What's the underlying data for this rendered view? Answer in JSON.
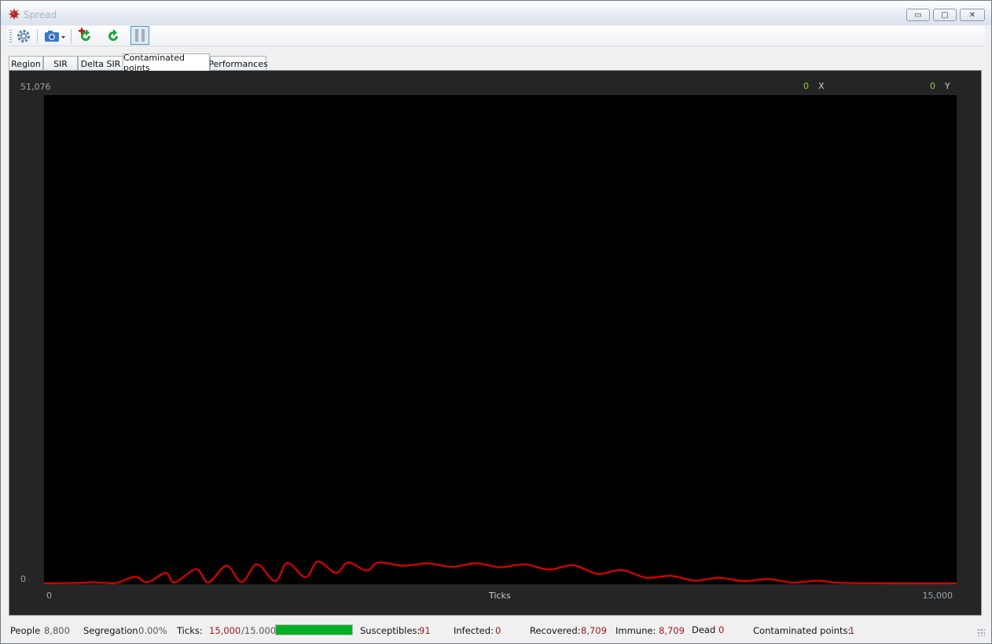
{
  "window": {
    "title": "Spread",
    "minimize_glyph": "▭",
    "maximize_glyph": "▢",
    "close_glyph": "✕"
  },
  "toolbar": {
    "icons": [
      "gear-icon",
      "camera-dropdown-icon",
      "restart-new-icon",
      "restart-icon",
      "pause-icon"
    ]
  },
  "tabs": [
    {
      "label": "Region",
      "active": false
    },
    {
      "label": "SIR",
      "active": false
    },
    {
      "label": "Delta SIR",
      "active": false
    },
    {
      "label": "Contaminated points",
      "active": true
    },
    {
      "label": "Performances",
      "active": false
    }
  ],
  "chart_header": {
    "x_value": "0",
    "x_label": "X",
    "y_value": "0",
    "y_label": "Y"
  },
  "chart_data": {
    "type": "line",
    "xlabel": "Ticks",
    "ylabel": "",
    "xlim": [
      0,
      15000
    ],
    "ylim": [
      0,
      51076
    ],
    "x_tick_labels": [
      "0",
      "15,000"
    ],
    "y_tick_labels": [
      "51,076",
      "0"
    ],
    "series_color": "#e00000",
    "series": [
      {
        "name": "",
        "points": [
          [
            0,
            0
          ],
          [
            500,
            50
          ],
          [
            800,
            120
          ],
          [
            1000,
            60
          ],
          [
            1200,
            60
          ],
          [
            1500,
            700
          ],
          [
            1700,
            120
          ],
          [
            2000,
            1100
          ],
          [
            2150,
            100
          ],
          [
            2500,
            1500
          ],
          [
            2700,
            100
          ],
          [
            3000,
            1850
          ],
          [
            3250,
            150
          ],
          [
            3500,
            2000
          ],
          [
            3800,
            250
          ],
          [
            4000,
            2150
          ],
          [
            4300,
            650
          ],
          [
            4500,
            2300
          ],
          [
            4800,
            1100
          ],
          [
            5000,
            2200
          ],
          [
            5300,
            1350
          ],
          [
            5500,
            2200
          ],
          [
            5900,
            1850
          ],
          [
            6300,
            2100
          ],
          [
            6700,
            1750
          ],
          [
            7100,
            2100
          ],
          [
            7500,
            1700
          ],
          [
            7900,
            2000
          ],
          [
            8300,
            1450
          ],
          [
            8700,
            1900
          ],
          [
            9100,
            1000
          ],
          [
            9500,
            1400
          ],
          [
            9900,
            600
          ],
          [
            10300,
            800
          ],
          [
            10700,
            300
          ],
          [
            11100,
            600
          ],
          [
            11500,
            250
          ],
          [
            11900,
            450
          ],
          [
            12300,
            100
          ],
          [
            12700,
            280
          ],
          [
            13000,
            100
          ],
          [
            13300,
            30
          ],
          [
            14000,
            10
          ],
          [
            15000,
            0
          ]
        ]
      }
    ]
  },
  "status": {
    "people_label": "People",
    "people_value": "8,800",
    "segregation_label": "Segregation",
    "segregation_value": "0.00%",
    "ticks_label": "Ticks:",
    "ticks_value": "15,000",
    "ticks_total": "/15.000",
    "progress": 1.0,
    "susceptibles_label": "Susceptibles:",
    "susceptibles_value": "91",
    "infected_label": "Infected:",
    "infected_value": "0",
    "recovered_label": "Recovered:",
    "recovered_value": "8,709",
    "immune_label": "Immune:",
    "immune_value": "8,709",
    "dead_label": "Dead",
    "dead_value": "0",
    "contaminated_label": "Contaminated points:",
    "contaminated_value": "1"
  }
}
